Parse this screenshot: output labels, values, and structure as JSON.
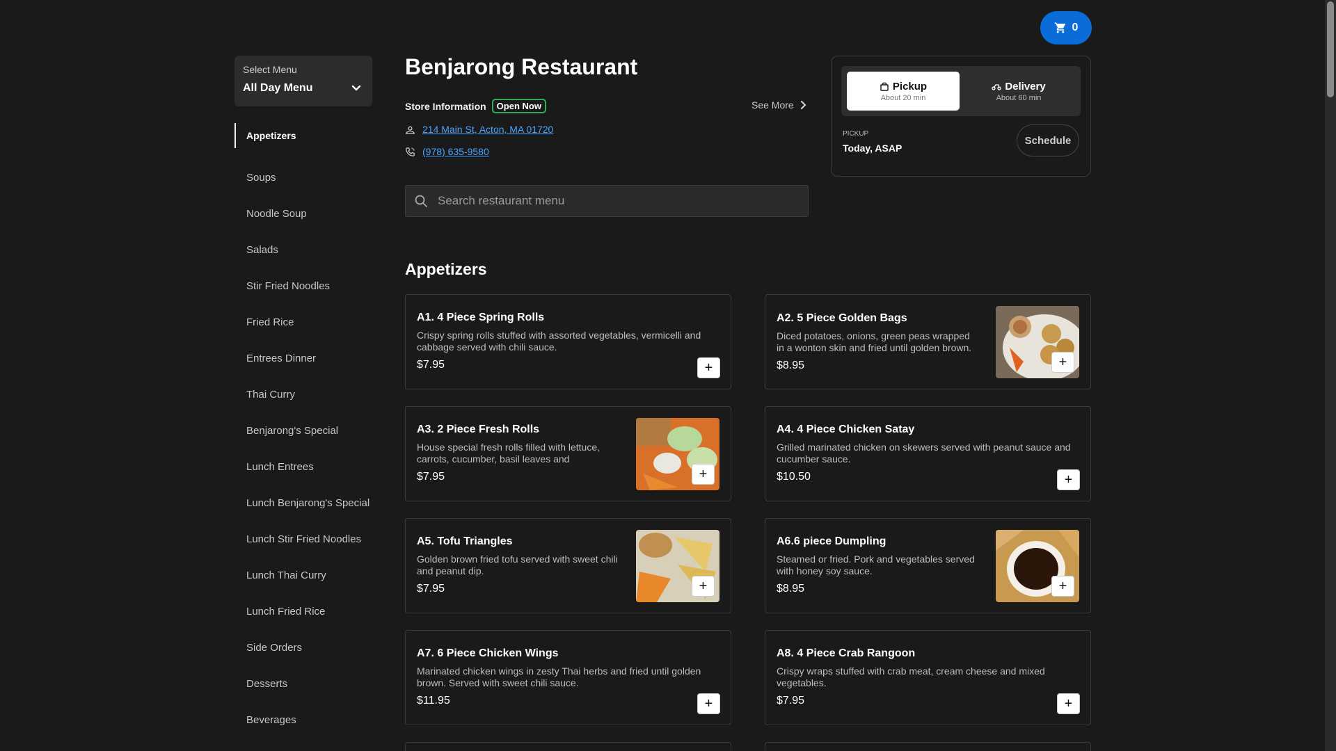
{
  "cart": {
    "count": "0"
  },
  "menu_select": {
    "label": "Select Menu",
    "value": "All Day Menu"
  },
  "categories": [
    "Appetizers",
    "Soups",
    "Noodle Soup",
    "Salads",
    "Stir Fried Noodles",
    "Fried Rice",
    "Entrees Dinner",
    "Thai Curry",
    "Benjarong's Special",
    "Lunch Entrees",
    "Lunch Benjarong's Special",
    "Lunch Stir Fried Noodles",
    "Lunch Thai Curry",
    "Lunch Fried Rice",
    "Side Orders",
    "Desserts",
    "Beverages"
  ],
  "restaurant": {
    "name": "Benjarong Restaurant",
    "store_info_label": "Store Information",
    "status": "Open Now",
    "see_more": "See More",
    "address": "214 Main St, Acton, MA 01720",
    "phone": "(978) 635-9580"
  },
  "search": {
    "placeholder": "Search restaurant menu"
  },
  "order": {
    "pickup_label": "Pickup",
    "pickup_time": "About 20 min",
    "delivery_label": "Delivery",
    "delivery_time": "About 60 min",
    "mode_caption": "PICKUP",
    "when": "Today, ASAP",
    "schedule_label": "Schedule"
  },
  "section": {
    "title": "Appetizers"
  },
  "items": [
    {
      "name": "A1. 4 Piece Spring Rolls",
      "desc": "Crispy spring rolls stuffed with assorted vegetables, vermicelli and cabbage served with chili sauce.",
      "price": "$7.95"
    },
    {
      "name": "A2. 5 Piece Golden Bags",
      "desc": "Diced potatoes, onions, green peas wrapped in a wonton skin and fried until golden brown.",
      "price": "$8.95"
    },
    {
      "name": "A3. 2 Piece Fresh Rolls",
      "desc": "House special fresh rolls filled with lettuce, carrots, cucumber, basil leaves and vermicelli…",
      "price": "$7.95"
    },
    {
      "name": "A4. 4 Piece Chicken Satay",
      "desc": "Grilled marinated chicken on skewers served with peanut sauce and cucumber sauce.",
      "price": "$10.50"
    },
    {
      "name": "A5. Tofu Triangles",
      "desc": "Golden brown fried tofu served with sweet chili and peanut dip.",
      "price": "$7.95"
    },
    {
      "name": "A6.6 piece Dumpling",
      "desc": "Steamed or fried. Pork and vegetables served with honey soy sauce.",
      "price": "$8.95"
    },
    {
      "name": "A7. 6 Piece Chicken Wings",
      "desc": "Marinated chicken wings in zesty Thai herbs and fried until golden brown. Served with sweet chili sauce.",
      "price": "$11.95"
    },
    {
      "name": "A8. 4 Piece Crab Rangoon",
      "desc": "Crispy wraps stuffed with crab meat, cream cheese and mixed vegetables.",
      "price": "$7.95"
    }
  ],
  "add_label": "+",
  "colors": {
    "accent": "#0a6cd8",
    "open_badge": "#2fae5a",
    "link": "#4aa3ff"
  }
}
